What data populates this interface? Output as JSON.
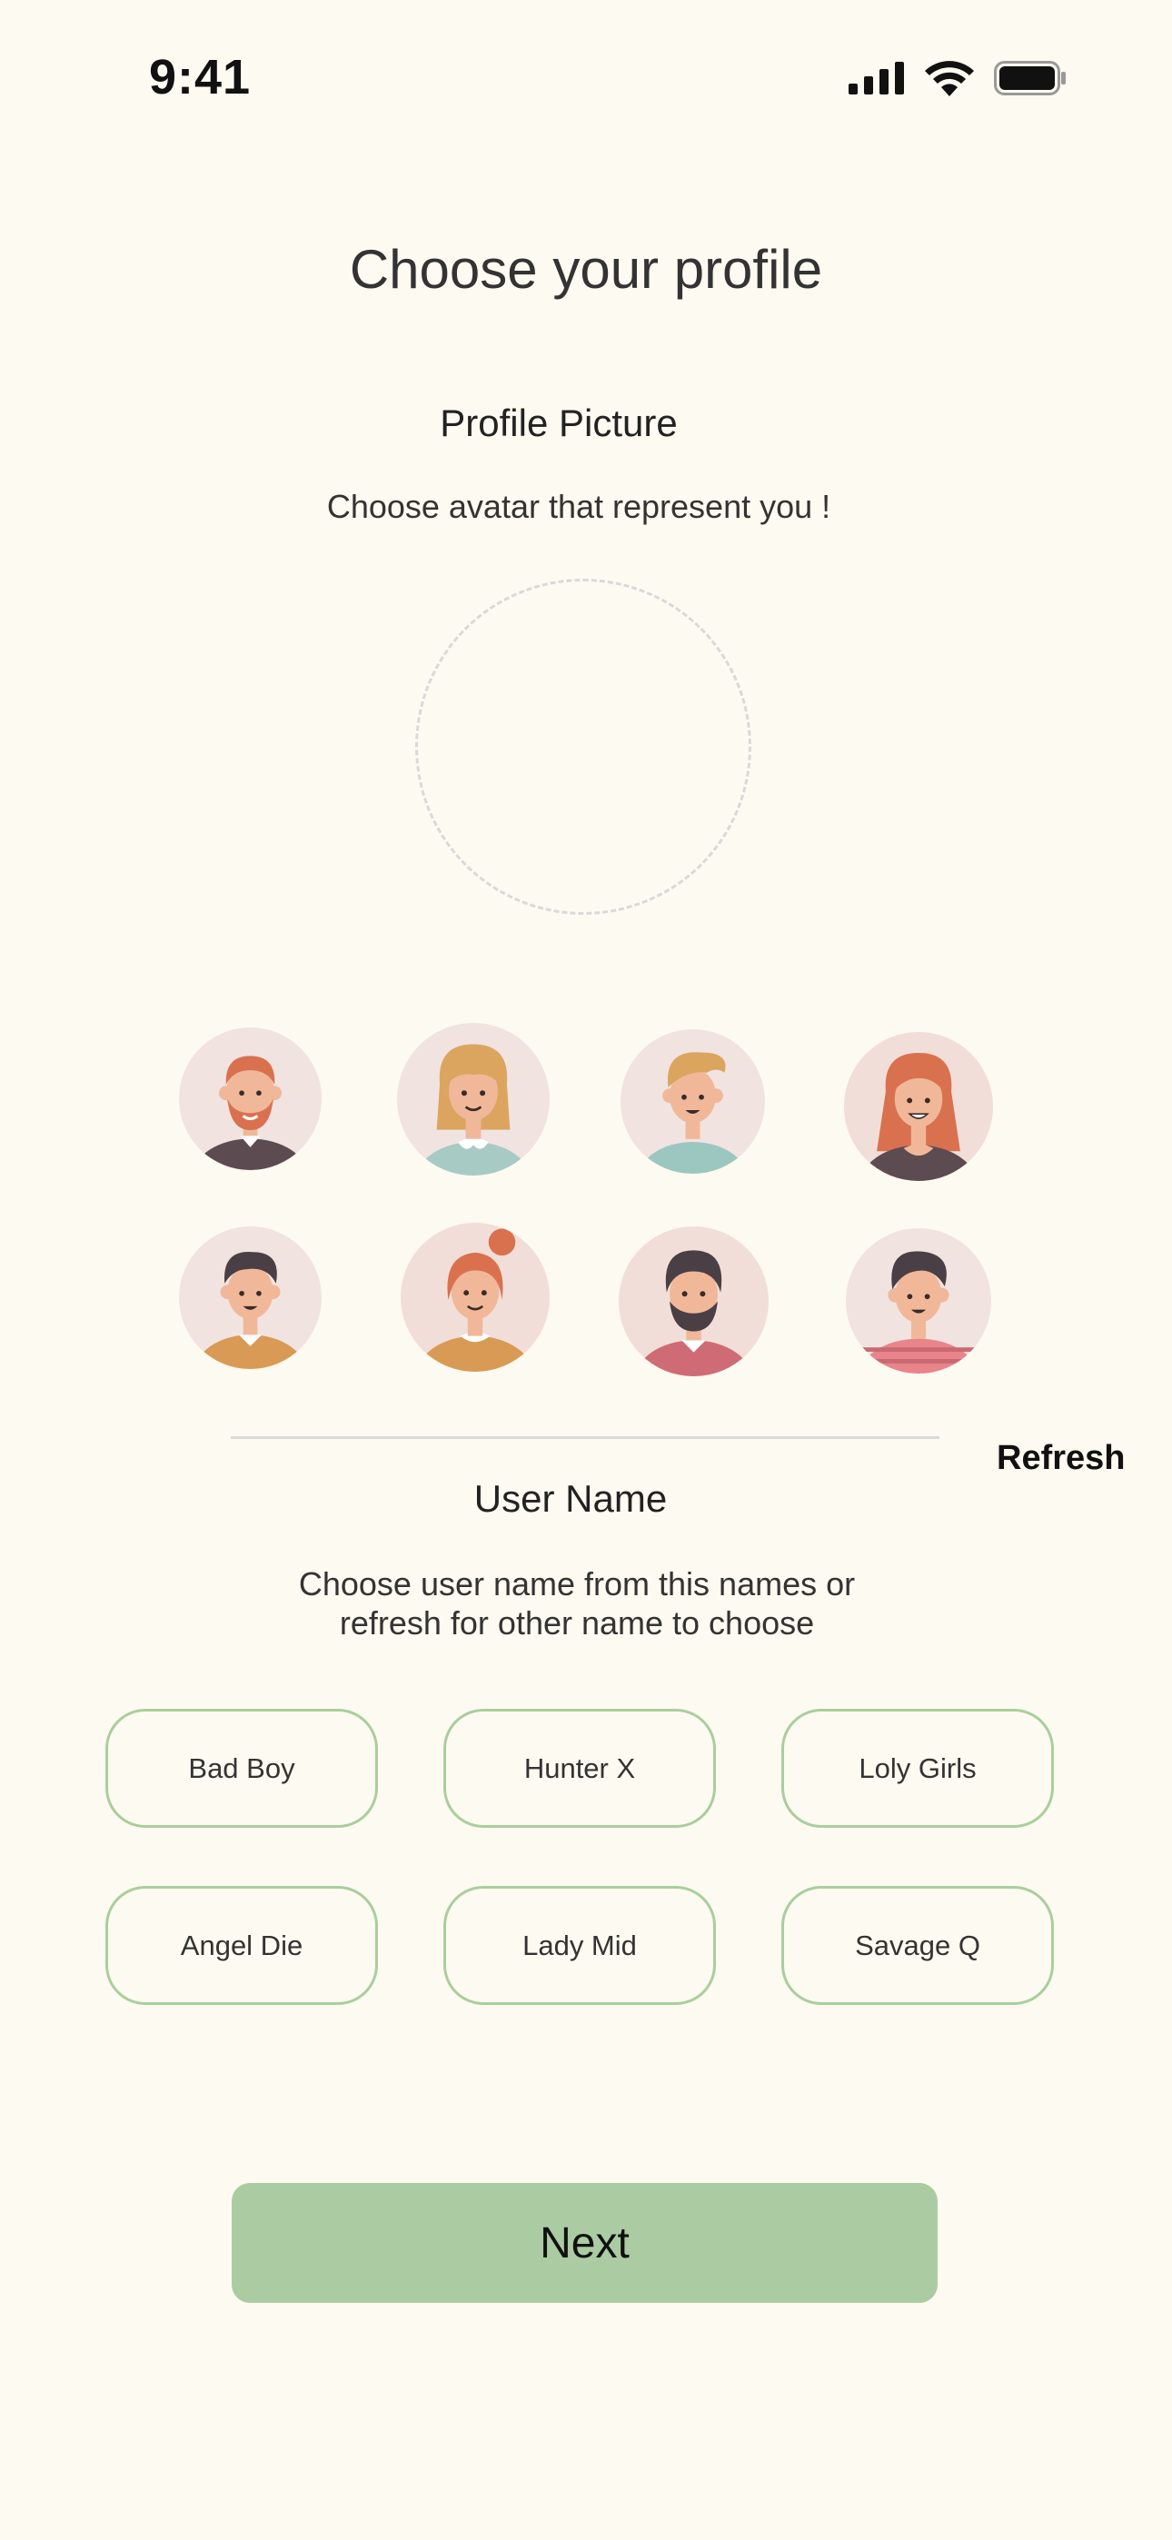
{
  "status_bar": {
    "time": "9:41",
    "icons": [
      "signal-icon",
      "wifi-icon",
      "battery-icon"
    ]
  },
  "title": "Choose your profile",
  "profile_picture": {
    "label": "Profile Picture",
    "description": "Choose avatar that represent you !"
  },
  "avatars": [
    {
      "name": "avatar-man-red-beard"
    },
    {
      "name": "avatar-woman-blonde"
    },
    {
      "name": "avatar-boy-blonde"
    },
    {
      "name": "avatar-woman-red-hair"
    },
    {
      "name": "avatar-man-dark-hair"
    },
    {
      "name": "avatar-woman-bun"
    },
    {
      "name": "avatar-man-dark-beard"
    },
    {
      "name": "avatar-boy-striped-shirt"
    }
  ],
  "refresh_label": "Refresh",
  "user_name": {
    "label": "User Name",
    "description_line1": "Choose user name from this names or",
    "description_line2": "refresh for other name to choose",
    "options": [
      "Bad Boy",
      "Hunter X",
      "Loly Girls",
      "Angel Die",
      "Lady Mid",
      "Savage Q"
    ]
  },
  "next_label": "Next",
  "colors": {
    "background": "#fdfaf1",
    "accent_green": "#abcca2",
    "chip_border": "#a9cf9c"
  }
}
